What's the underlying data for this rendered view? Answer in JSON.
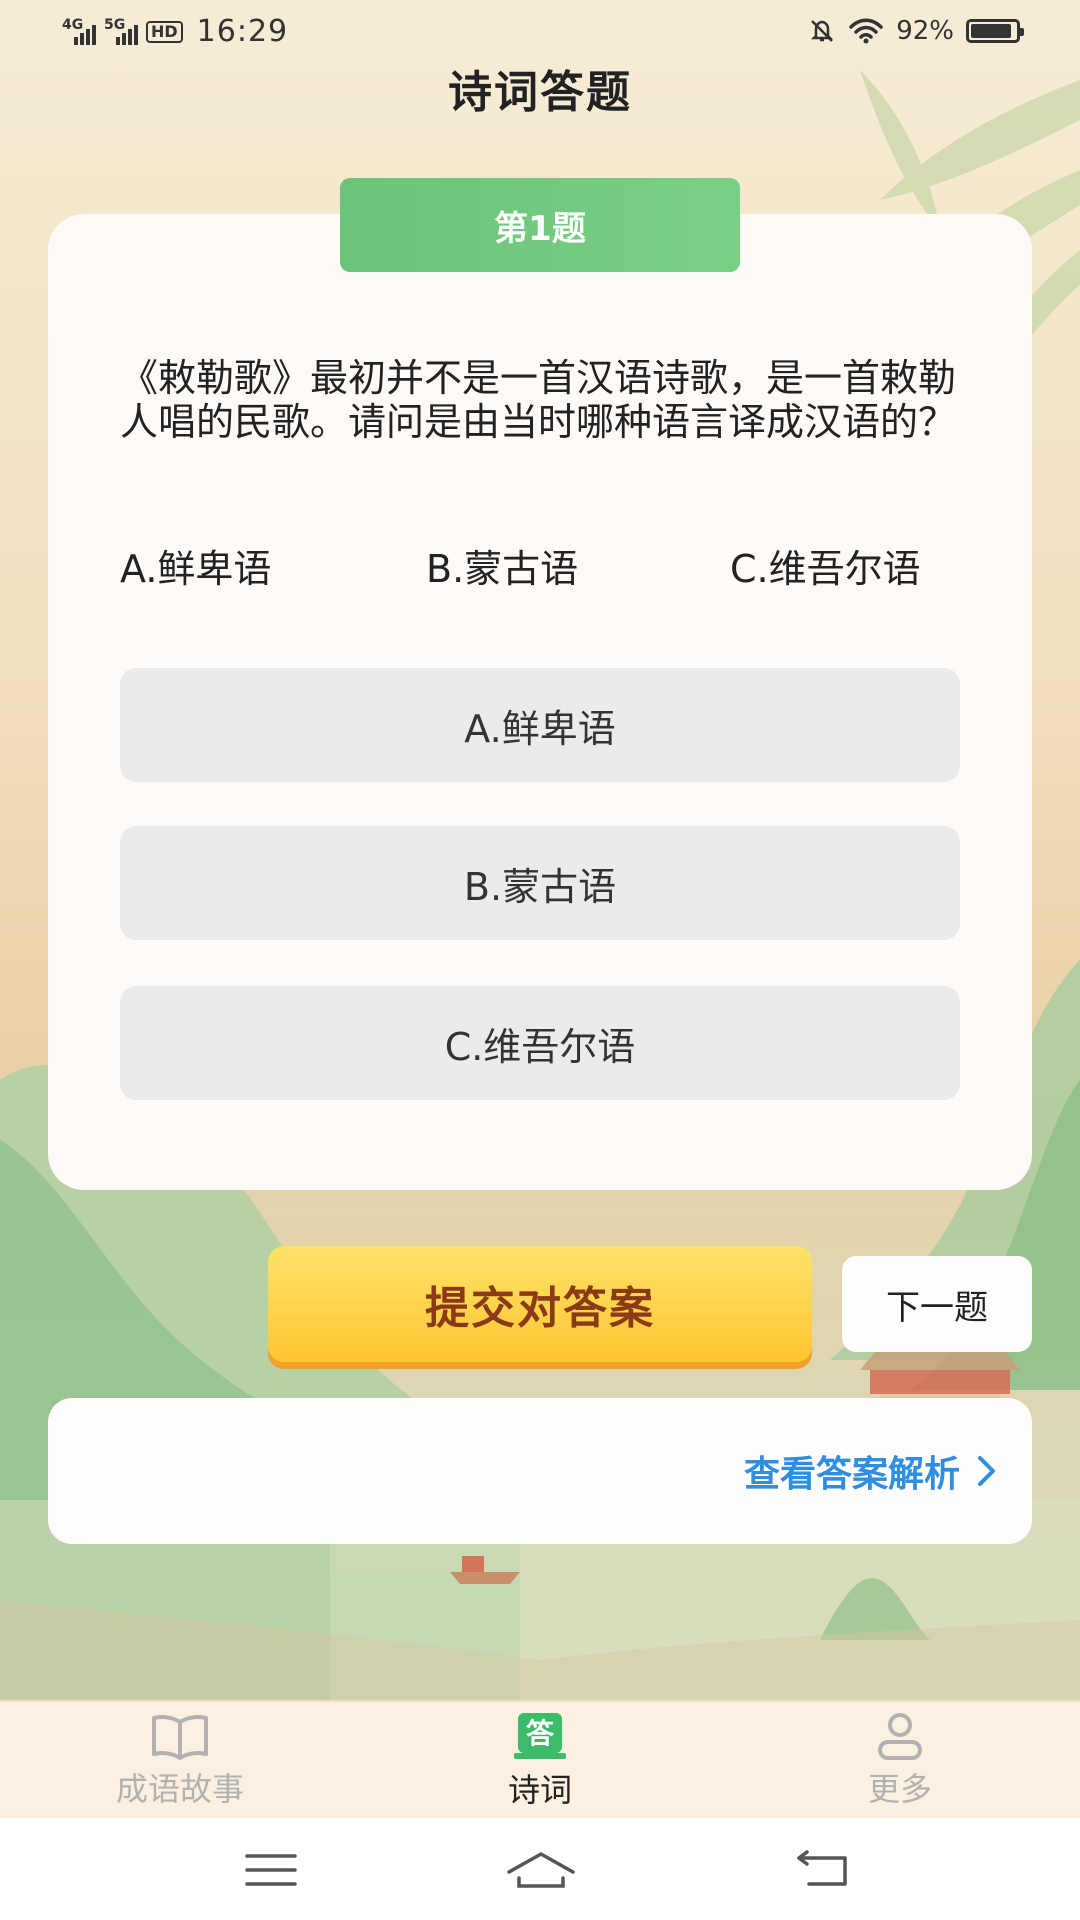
{
  "status_bar": {
    "network_1": "4G",
    "network_2": "5G",
    "hd_label": "HD",
    "time": "16:29",
    "battery_percent": "92%",
    "battery_level": 0.92,
    "icons": [
      "signal-icon",
      "hd-voice-icon",
      "mute-icon",
      "wifi-icon",
      "battery-icon"
    ]
  },
  "header": {
    "title": "诗词答题"
  },
  "question": {
    "badge": "第1题",
    "text": "《敕勒歌》最初并不是一首汉语诗歌，是一首敕勒人唱的民歌。请问是由当时哪种语言译成汉语的？",
    "options_inline": [
      "A.鲜卑语",
      "B.蒙古语",
      "C.维吾尔语"
    ],
    "option_buttons": [
      "A.鲜卑语",
      "B.蒙古语",
      "C.维吾尔语"
    ]
  },
  "actions": {
    "submit_label": "提交对答案",
    "next_label": "下一题",
    "analysis_label": "查看答案解析"
  },
  "tab_bar": {
    "items": [
      {
        "label": "成语故事",
        "icon": "book-icon",
        "active": false
      },
      {
        "label": "诗词",
        "icon": "answer-icon",
        "active": true,
        "icon_text": "答"
      },
      {
        "label": "更多",
        "icon": "user-icon",
        "active": false
      }
    ]
  },
  "nav_bar": {
    "icons": [
      "menu-icon",
      "home-icon",
      "back-icon"
    ]
  },
  "colors": {
    "badge_green": "#6cc47a",
    "submit_yellow": "#ffc531",
    "submit_text": "#8a3a16",
    "link_blue": "#2f8ee2",
    "tab_active_green": "#3dbb6a"
  }
}
